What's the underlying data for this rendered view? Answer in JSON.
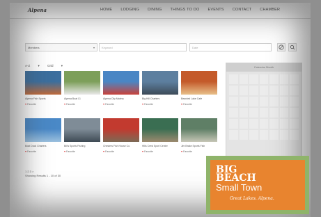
{
  "nav": {
    "logo": "Alpena",
    "links": [
      "HOME",
      "LODGING",
      "DINING",
      "THINGS TO DO",
      "EVENTS",
      "CONTACT",
      "CHAMBER"
    ]
  },
  "search": {
    "category_value": "Members",
    "keyword_placeholder": "Keyword",
    "date_placeholder": "Date"
  },
  "filters": {
    "sort": "A-Z",
    "view": "Grid"
  },
  "listings": [
    {
      "name": "Alpena Fish Sports",
      "fav": "Favorite",
      "colors": [
        "#3c6f9e",
        "#c06a3a"
      ]
    },
    {
      "name": "Alpena Boat Cl.",
      "fav": "Favorite",
      "colors": [
        "#7d9f5a",
        "#e8e8e8"
      ]
    },
    {
      "name": "Alpena City Marina",
      "fav": "Favorite",
      "colors": [
        "#4a86c4",
        "#c9423a"
      ]
    },
    {
      "name": "Big Hill Charters",
      "fav": "Favorite",
      "colors": [
        "#5d7f9f",
        "#3d4b58"
      ]
    },
    {
      "name": "Bearded Lake Cafe",
      "fav": "Favorite",
      "colors": [
        "#c45a2a",
        "#e8c08a"
      ]
    },
    {
      "name": "Boat Dock Charters",
      "fav": "Favorite",
      "colors": [
        "#4a89c7",
        "#9bc0de"
      ]
    },
    {
      "name": "Bill's Sports Fishing",
      "fav": "Favorite",
      "colors": [
        "#7f8c97",
        "#3f4b55"
      ]
    },
    {
      "name": "Chesters Fish House Co.",
      "fav": "Favorite",
      "colors": [
        "#c23a2f",
        "#7d6a55"
      ]
    },
    {
      "name": "Hills Crest Sport Center",
      "fav": "Favorite",
      "colors": [
        "#3a6e52",
        "#9c8a6f"
      ]
    },
    {
      "name": "Jim Brake Sports Fish",
      "fav": "Favorite",
      "colors": [
        "#5f7f66",
        "#c6c6b6"
      ]
    }
  ],
  "pager": {
    "pages": "1 2 3 >",
    "showing": "Showing Results 1 - 10 of 30"
  },
  "calendar": {
    "title": "Calendar Month"
  },
  "ad": {
    "line1": "BIG",
    "line2": "BEACH",
    "line3": "Small Town",
    "tagline": "Great Lakes. Alpena.",
    "color": "#e8842f",
    "border_color": "#8fb46a"
  }
}
